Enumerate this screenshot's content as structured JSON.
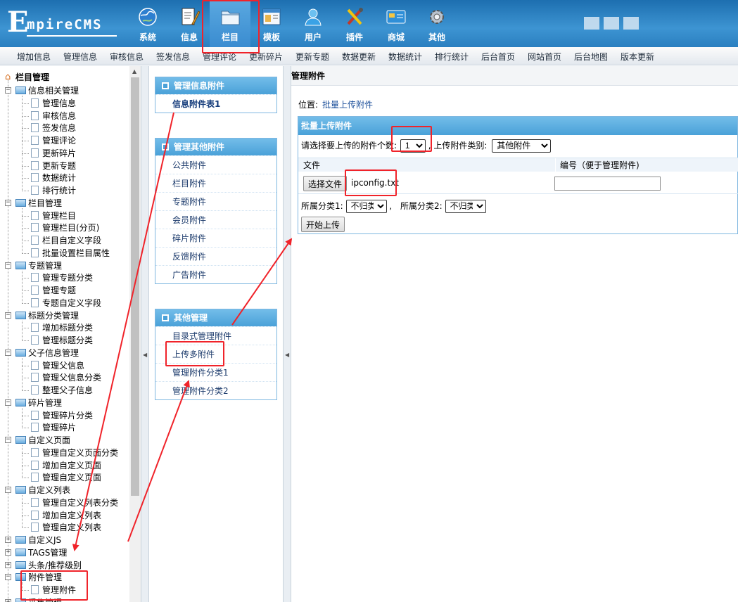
{
  "logo": {
    "first": "E",
    "rest": "mpireCMS"
  },
  "topnav": [
    {
      "label": "系统",
      "icon": "globe-icon"
    },
    {
      "label": "信息",
      "icon": "document-pen-icon"
    },
    {
      "label": "栏目",
      "icon": "folder-icon"
    },
    {
      "label": "模板",
      "icon": "window-template-icon"
    },
    {
      "label": "用户",
      "icon": "user-icon"
    },
    {
      "label": "插件",
      "icon": "tools-icon"
    },
    {
      "label": "商城",
      "icon": "card-icon"
    },
    {
      "label": "其他",
      "icon": "gear-icon"
    }
  ],
  "subnav": [
    "增加信息",
    "管理信息",
    "审核信息",
    "签发信息",
    "管理评论",
    "更新碎片",
    "更新专题",
    "数据更新",
    "数据统计",
    "排行统计",
    "后台首页",
    "网站首页",
    "后台地图",
    "版本更新"
  ],
  "tree": {
    "root": "栏目管理",
    "groups": [
      {
        "label": "信息相关管理",
        "open": true,
        "items": [
          "管理信息",
          "审核信息",
          "签发信息",
          "管理评论",
          "更新碎片",
          "更新专题",
          "数据统计",
          "排行统计"
        ]
      },
      {
        "label": "栏目管理",
        "open": true,
        "items": [
          "管理栏目",
          "管理栏目(分页)",
          "栏目自定义字段",
          "批量设置栏目属性"
        ]
      },
      {
        "label": "专题管理",
        "open": true,
        "items": [
          "管理专题分类",
          "管理专题",
          "专题自定义字段"
        ]
      },
      {
        "label": "标题分类管理",
        "open": true,
        "items": [
          "增加标题分类",
          "管理标题分类"
        ]
      },
      {
        "label": "父子信息管理",
        "open": true,
        "items": [
          "管理父信息",
          "管理父信息分类",
          "整理父子信息"
        ]
      },
      {
        "label": "碎片管理",
        "open": true,
        "items": [
          "管理碎片分类",
          "管理碎片"
        ]
      },
      {
        "label": "自定义页面",
        "open": true,
        "items": [
          "管理自定义页面分类",
          "增加自定义页面",
          "管理自定义页面"
        ]
      },
      {
        "label": "自定义列表",
        "open": true,
        "items": [
          "管理自定义列表分类",
          "增加自定义列表",
          "管理自定义列表"
        ]
      },
      {
        "label": "自定义JS",
        "open": false,
        "items": []
      },
      {
        "label": "TAGS管理",
        "open": false,
        "items": []
      },
      {
        "label": "头条/推荐级别",
        "open": false,
        "items": []
      },
      {
        "label": "附件管理",
        "open": true,
        "items": [
          "管理附件"
        ]
      },
      {
        "label": "采集管理",
        "open": false,
        "items": []
      }
    ]
  },
  "menu": {
    "box1": {
      "title": "管理信息附件",
      "items": [
        "信息附件表1"
      ]
    },
    "box2": {
      "title": "管理其他附件",
      "items": [
        "公共附件",
        "栏目附件",
        "专题附件",
        "会员附件",
        "碎片附件",
        "反馈附件",
        "广告附件"
      ]
    },
    "box3": {
      "title": "其他管理",
      "items": [
        "目录式管理附件",
        "上传多附件",
        "管理附件分类1",
        "管理附件分类2"
      ]
    }
  },
  "main": {
    "title": "管理附件",
    "location_label": "位置:",
    "location_link": "批量上传附件",
    "form_title": "批量上传附件",
    "count_label": "请选择要上传的附件个数:",
    "count_value": "1",
    "type_label": ", 上传附件类别:",
    "type_value": "其他附件",
    "col_file": "文件",
    "col_number": "编号（便于管理附件)",
    "choose_button": "选择文件",
    "chosen_file": "ipconfig.txt",
    "number_value": "",
    "cat1_label": "所属分类1:",
    "cat1_value": "不归类",
    "cat_sep": ",",
    "cat2_label": "所属分类2:",
    "cat2_value": "不归类",
    "start_button": "开始上传"
  },
  "colors": {
    "accent": "#4aa1d8",
    "annotation": "#f0232a",
    "link": "#1b4f9a"
  }
}
